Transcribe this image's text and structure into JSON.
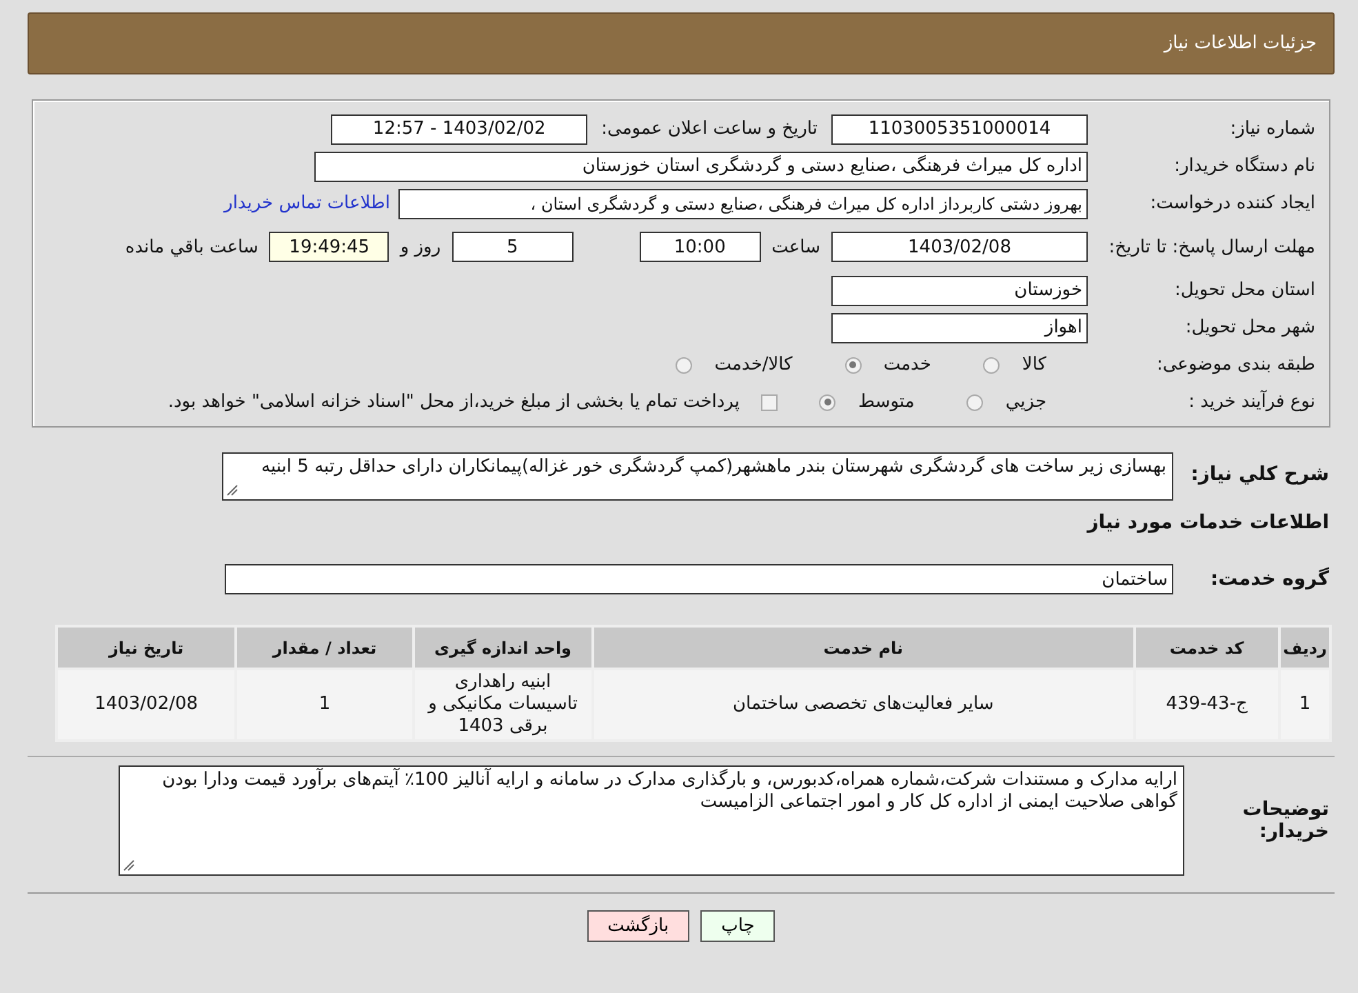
{
  "header": {
    "title": "جزئیات اطلاعات نیاز"
  },
  "details": {
    "need_number": {
      "label": "شماره نیاز:",
      "value": "1103005351000014"
    },
    "announce_date": {
      "label": "تاریخ و ساعت اعلان عمومی:",
      "value": "1403/02/02 - 12:57"
    },
    "buyer_org": {
      "label": "نام دستگاه خریدار:",
      "value": "اداره کل میراث فرهنگی ،صنایع دستی و گردشگری استان خوزستان"
    },
    "requester": {
      "label": "ایجاد کننده درخواست:",
      "value": "بهروز دشتی کاربرداز اداره کل میراث فرهنگی ،صنایع دستی و گردشگری استان ،",
      "link": "اطلاعات تماس خریدار"
    },
    "deadline": {
      "label": "مهلت ارسال پاسخ: تا تاریخ:",
      "date": "1403/02/08",
      "time_label": "ساعت",
      "time": "10:00",
      "days": "5",
      "days_label": "روز و",
      "remaining": "19:49:45",
      "remaining_label": "ساعت باقي مانده"
    },
    "province": {
      "label": "استان محل تحویل:",
      "value": "خوزستان"
    },
    "city": {
      "label": "شهر محل تحویل:",
      "value": "اهواز"
    },
    "category": {
      "label": "طبقه بندی موضوعی:",
      "options": [
        {
          "label": "کالا",
          "selected": false
        },
        {
          "label": "خدمت",
          "selected": true
        },
        {
          "label": "کالا/خدمت",
          "selected": false
        }
      ]
    },
    "purchase_type": {
      "label": "نوع فرآیند خرید :",
      "options": [
        {
          "label": "جزيي",
          "selected": false
        },
        {
          "label": "متوسط",
          "selected": true
        }
      ],
      "treasury": {
        "label": "پرداخت تمام یا بخشی از مبلغ خرید،از محل \"اسناد خزانه اسلامی\" خواهد بود.",
        "checked": false
      }
    }
  },
  "description": {
    "label": "شرح کلي نیاز:",
    "value": "بهسازی زیر ساخت های گردشگری شهرستان بندر ماهشهر(کمپ گردشگری خور غزاله)پیمانکاران  دارای حداقل رتبه 5 ابنیه"
  },
  "services": {
    "title": "اطلاعات خدمات مورد نیاز",
    "group": {
      "label": "گروه خدمت:",
      "value": "ساختمان"
    },
    "table": {
      "columns": [
        "ردیف",
        "کد خدمت",
        "نام خدمت",
        "واحد اندازه گیری",
        "تعداد / مقدار",
        "تاریخ نیاز"
      ],
      "rows": [
        [
          "1",
          "ج-43-439",
          "سایر فعالیت‌های تخصصی ساختمان",
          "ابنیه راهداری تاسیسات مکانیکی و برقی 1403",
          "1",
          "1403/02/08"
        ]
      ]
    }
  },
  "buyer_notes": {
    "label": "توضیحات خریدار:",
    "value": "ارایه مدارک و مستندات شرکت،شماره همراه،کدبورس، و بارگذاری مدارک در سامانه و ارایه آنالیز 100٪ آیتم‌های برآورد قیمت ودارا بودن گواهی صلاحیت ایمنی از اداره کل کار و امور اجتماعی الزامیست"
  },
  "buttons": [
    {
      "label": "چاپ",
      "kind": "print"
    },
    {
      "label": "بازگشت",
      "kind": "back"
    }
  ]
}
